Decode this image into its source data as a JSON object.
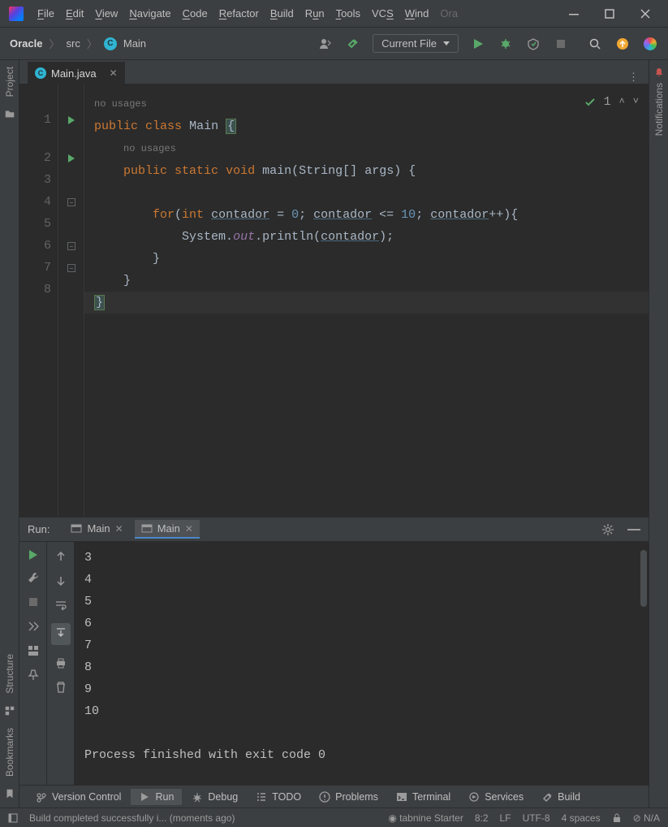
{
  "menu": {
    "items": [
      "File",
      "Edit",
      "View",
      "Navigate",
      "Code",
      "Refactor",
      "Build",
      "Run",
      "Tools",
      "VCS",
      "Window",
      "Oracle"
    ]
  },
  "window": {
    "project": "Oracle"
  },
  "breadcrumb": {
    "root": "Oracle",
    "src": "src",
    "file": "Main"
  },
  "toolbar": {
    "run_config": "Current File"
  },
  "tabs": {
    "file": "Main.java"
  },
  "editor": {
    "usages1": "no usages",
    "usages2": "no usages",
    "line1_public": "public",
    "line1_class": "class",
    "line1_main": "Main",
    "l2_public": "public",
    "l2_static": "static",
    "l2_void": "void",
    "l2_main": "main",
    "l2_string": "String",
    "l2_brackets": "[]",
    "l2_args": "args",
    "l4_for": "for",
    "l4_int": "int",
    "l4_var": "contador",
    "l4_eq": " = ",
    "l4_zero": "0",
    "l4_semi": "; ",
    "l4_le": " <= ",
    "l4_ten": "10",
    "l4_inc": "++",
    "l5_system": "System",
    "l5_out": "out",
    "l5_println": "println",
    "l5_arg": "contador",
    "inspect_count": "1",
    "lines": [
      "1",
      "2",
      "3",
      "4",
      "5",
      "6",
      "7",
      "8"
    ]
  },
  "run_panel": {
    "title": "Run:",
    "tabs": [
      {
        "label": "Main"
      },
      {
        "label": "Main"
      }
    ],
    "output": [
      "3",
      "4",
      "5",
      "6",
      "7",
      "8",
      "9",
      "10",
      "",
      "Process finished with exit code 0"
    ]
  },
  "bottom_tools": [
    {
      "label": "Version Control",
      "icon": "branch"
    },
    {
      "label": "Run",
      "icon": "play",
      "active": true
    },
    {
      "label": "Debug",
      "icon": "bug"
    },
    {
      "label": "TODO",
      "icon": "list"
    },
    {
      "label": "Problems",
      "icon": "warn"
    },
    {
      "label": "Terminal",
      "icon": "term"
    },
    {
      "label": "Services",
      "icon": "services"
    },
    {
      "label": "Build",
      "icon": "hammer"
    }
  ],
  "status": {
    "message": "Build completed successfully i... (moments ago)",
    "tabnine": "tabnine Starter",
    "pos": "8:2",
    "sep": "LF",
    "enc": "UTF-8",
    "indent": "4 spaces",
    "na": "N/A"
  },
  "left_sidebar": {
    "project": "Project",
    "structure": "Structure",
    "bookmarks": "Bookmarks"
  },
  "right_sidebar": {
    "notifications": "Notifications"
  }
}
